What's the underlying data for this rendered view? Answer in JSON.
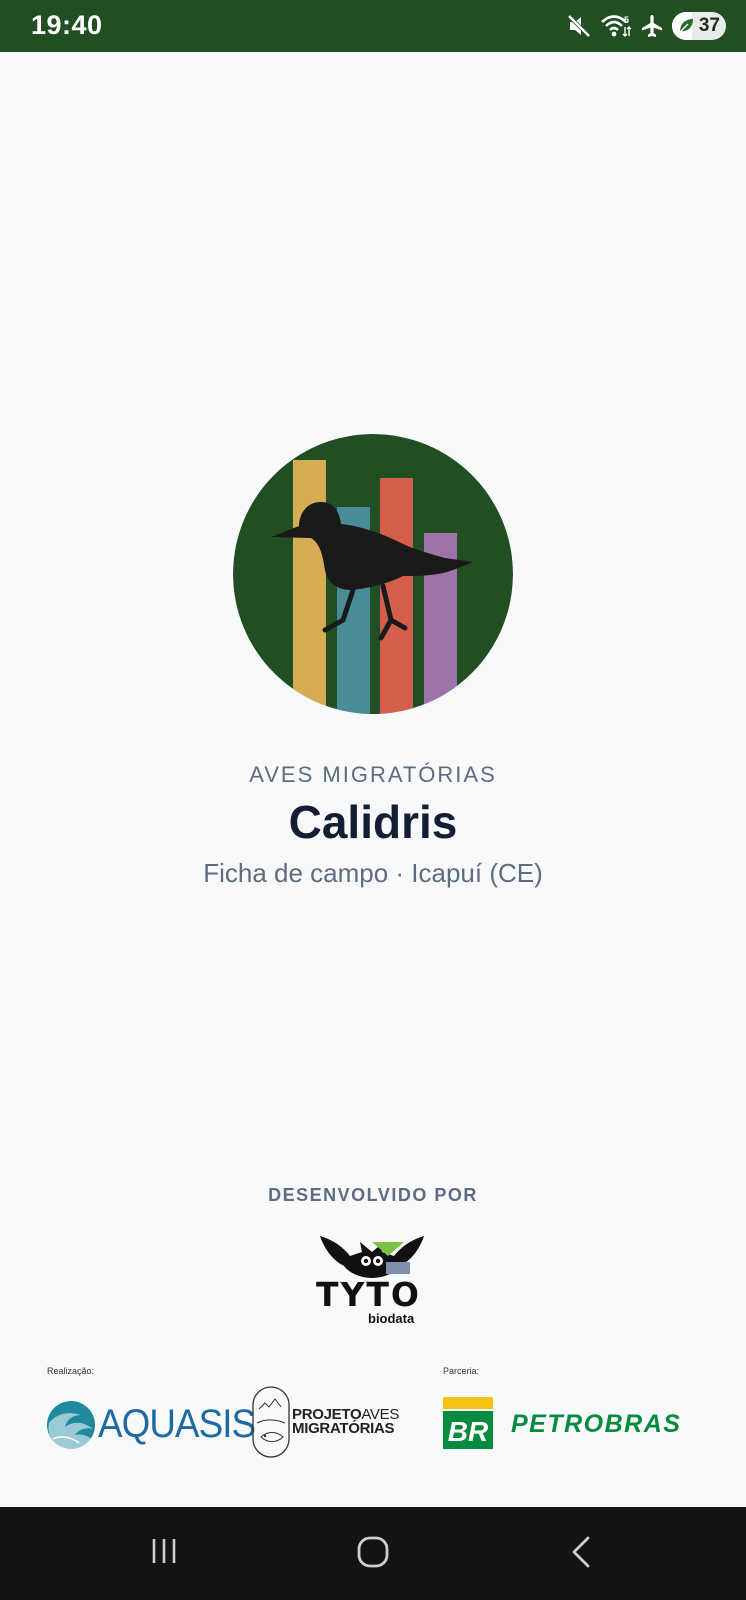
{
  "status_bar": {
    "time": "19:40",
    "battery_level": "37",
    "icons": [
      "mute-icon",
      "wifi-icon",
      "airplane-mode-icon",
      "battery-saver-icon"
    ]
  },
  "hero": {
    "bar_colors": [
      "#d6ad52",
      "#4a8c98",
      "#d4604c",
      "#9f72aa"
    ],
    "circle_color": "#214f23"
  },
  "header": {
    "eyebrow": "AVES MIGRATÓRIAS",
    "title": "Calidris",
    "subtitle": "Ficha de campo · Icapuí (CE)"
  },
  "footer": {
    "developed_by_label": "DESENVOLVIDO POR",
    "developer": {
      "name": "TYTO",
      "sub": "biodata"
    },
    "realizacao_label": "Realização:",
    "parceria_label": "Parceria:",
    "aquasis": "AQUASIS",
    "projeto_line1": "PROJETO",
    "projeto_line1b": "AVES",
    "projeto_line2": "MIGRATÓRIAS",
    "br": "BR",
    "petrobras": "PETROBRAS"
  },
  "nav_bar": {
    "buttons": [
      "recents-button",
      "home-button",
      "back-button"
    ]
  },
  "colors": {
    "status_bar_bg": "#214f23",
    "page_bg": "#f7f9fb",
    "title_color": "#131d33",
    "muted_text": "#5e6c80",
    "petrobras_green": "#078b3f",
    "petrobras_yellow": "#f5c216",
    "aquasis_blue": "#1f6aa0"
  }
}
